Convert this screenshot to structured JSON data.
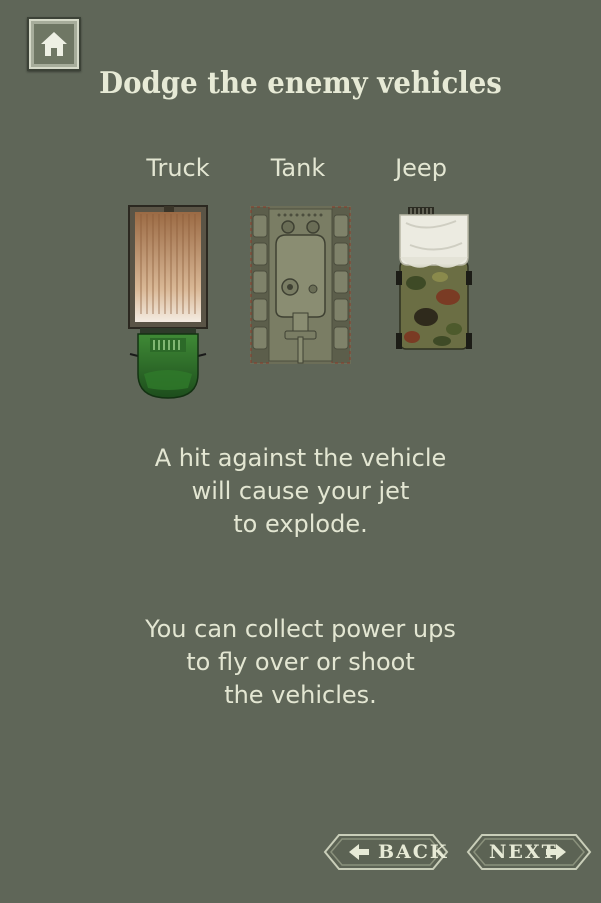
{
  "title": "Dodge the enemy vehicles",
  "vehicles": [
    {
      "label": "Truck"
    },
    {
      "label": "Tank"
    },
    {
      "label": "Jeep"
    }
  ],
  "paragraph1": [
    "A hit against the vehicle",
    "will cause your jet",
    "to explode."
  ],
  "paragraph2": [
    "You can collect power ups",
    "to fly over or shoot",
    "the vehicles."
  ],
  "nav": {
    "back_label": "BACK",
    "next_label": "NEXT"
  },
  "icons": {
    "home": "home-icon",
    "back_arrow": "arrow-left-icon",
    "next_arrow": "arrow-right-icon"
  },
  "colors": {
    "background": "#5f6658",
    "text": "#e3e6d2",
    "button_face": "#a7ad9b"
  }
}
